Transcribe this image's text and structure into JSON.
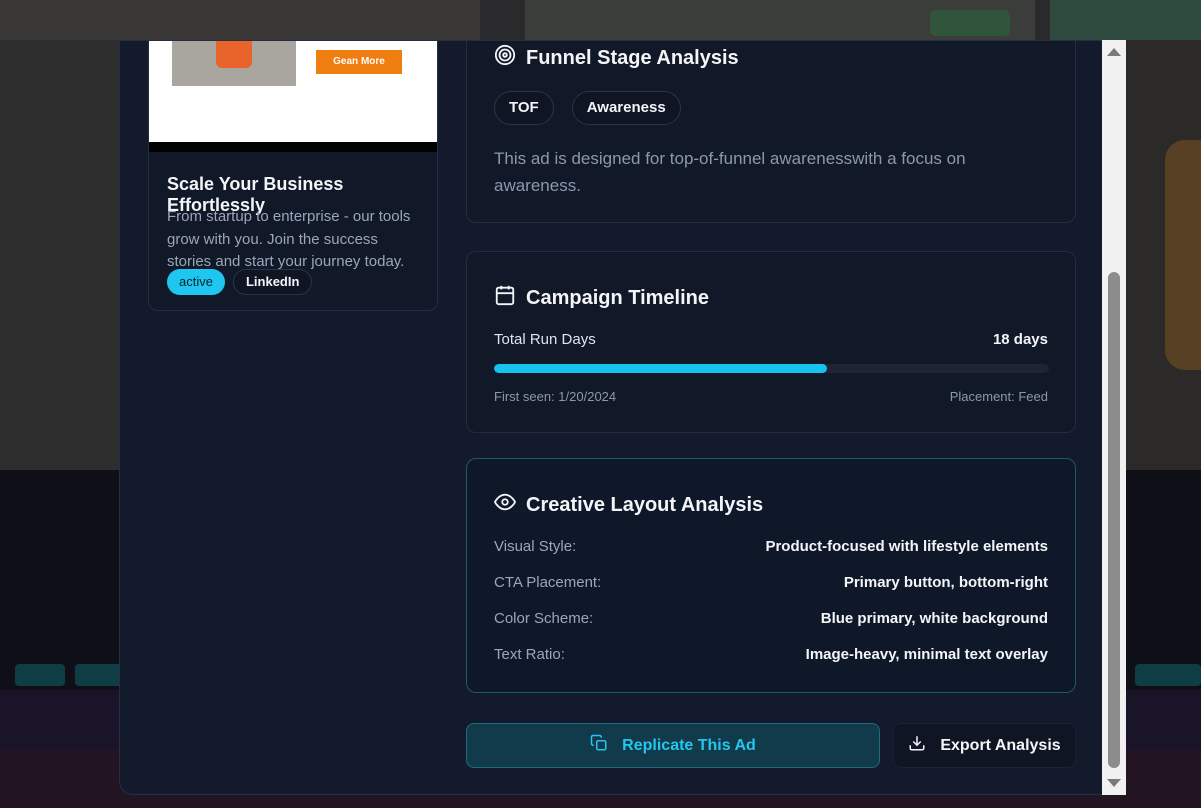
{
  "ad": {
    "image_cta": "Gean More",
    "title": "Scale Your Business Effortlessly",
    "description": "From startup to enterprise - our tools grow with you. Join the success stories and start your journey today.",
    "status": "active",
    "platform": "LinkedIn"
  },
  "funnel": {
    "title": "Funnel Stage Analysis",
    "chips": [
      "TOF",
      "Awareness"
    ],
    "description": "This ad is designed for top-of-funnel awarenesswith a focus on awareness."
  },
  "timeline": {
    "title": "Campaign Timeline",
    "run_label": "Total Run Days",
    "run_value": "18 days",
    "progress_percent": 60,
    "first_seen": "First seen: 1/20/2024",
    "placement": "Placement: Feed"
  },
  "layout": {
    "title": "Creative Layout Analysis",
    "rows": [
      {
        "key": "Visual Style:",
        "value": "Product-focused with lifestyle elements"
      },
      {
        "key": "CTA Placement:",
        "value": "Primary button, bottom-right"
      },
      {
        "key": "Color Scheme:",
        "value": "Blue primary, white background"
      },
      {
        "key": "Text Ratio:",
        "value": "Image-heavy, minimal text overlay"
      }
    ]
  },
  "actions": {
    "replicate_label": "Replicate This Ad",
    "export_label": "Export Analysis"
  },
  "colors": {
    "accent": "#17c2ee",
    "panel_bg": "#111827",
    "modal_bg": "#131a2b"
  }
}
